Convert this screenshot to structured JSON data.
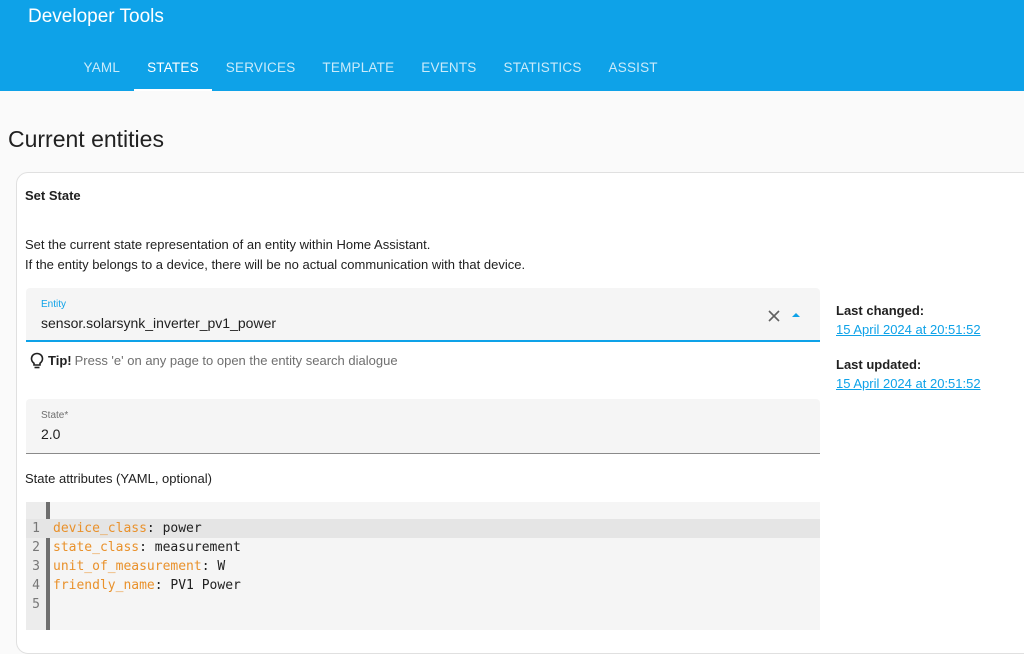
{
  "header": {
    "title": "Developer Tools",
    "tabs": [
      {
        "label": "YAML",
        "active": false
      },
      {
        "label": "STATES",
        "active": true
      },
      {
        "label": "SERVICES",
        "active": false
      },
      {
        "label": "TEMPLATE",
        "active": false
      },
      {
        "label": "EVENTS",
        "active": false
      },
      {
        "label": "STATISTICS",
        "active": false
      },
      {
        "label": "ASSIST",
        "active": false
      }
    ]
  },
  "page_title": "Current entities",
  "set_state": {
    "title": "Set State",
    "description_line1": "Set the current state representation of an entity within Home Assistant.",
    "description_line2": "If the entity belongs to a device, there will be no actual communication with that device.",
    "entity_label": "Entity",
    "entity_value": "sensor.solarsynk_inverter_pv1_power",
    "tip_strong": "Tip!",
    "tip_text": "Press 'e' on any page to open the entity search dialogue",
    "state_label": "State*",
    "state_value": "2.0",
    "attributes_label": "State attributes (YAML, optional)",
    "yaml_lines": [
      {
        "num": "1",
        "key": "device_class",
        "value": " power"
      },
      {
        "num": "2",
        "key": "state_class",
        "value": " measurement"
      },
      {
        "num": "3",
        "key": "unit_of_measurement",
        "value": " W"
      },
      {
        "num": "4",
        "key": "friendly_name",
        "value": " PV1 Power"
      },
      {
        "num": "5",
        "key": "",
        "value": ""
      }
    ]
  },
  "side": {
    "last_changed_label": "Last changed:",
    "last_changed_value": "15 April 2024 at 20:51:52",
    "last_updated_label": "Last updated:",
    "last_updated_value": "15 April 2024 at 20:51:52"
  },
  "icons": {
    "clear": "close-icon",
    "dropdown": "arrow-up-icon",
    "tip": "lightbulb-icon"
  },
  "colors": {
    "header_bg": "#0ea2e8",
    "accent": "#0ea2e8",
    "yaml_key": "#e9912b"
  }
}
